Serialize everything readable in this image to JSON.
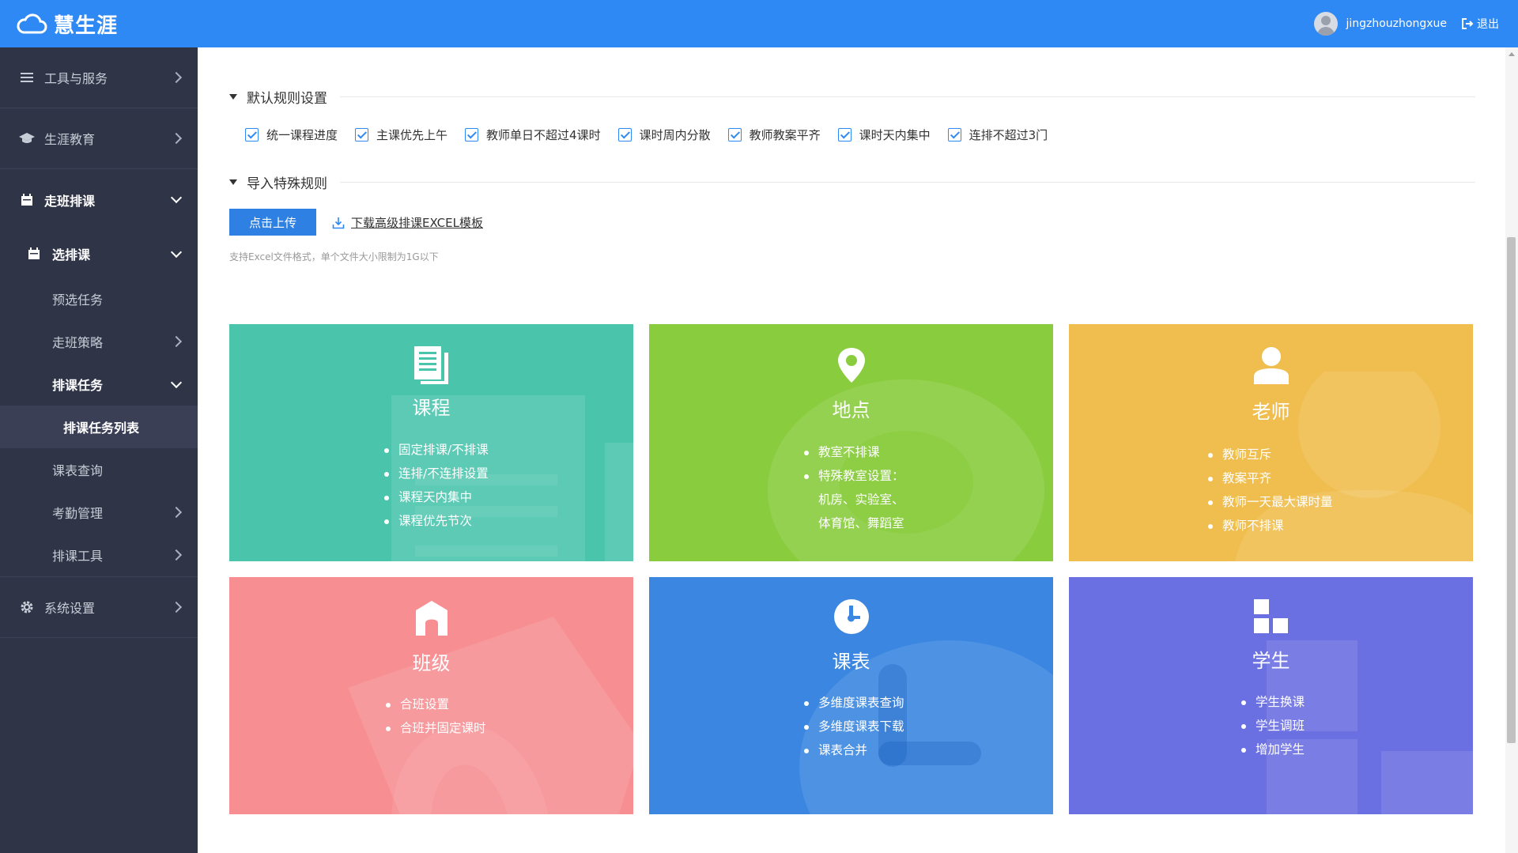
{
  "brand": {
    "name": "慧生涯"
  },
  "header": {
    "username": "jingzhouzhongxue",
    "logout_label": "退出"
  },
  "sidebar": {
    "tools": "工具与服务",
    "career": "生涯教育",
    "walking": "走班排课",
    "select": "选排课",
    "preselect": "预选任务",
    "strategy": "走班策略",
    "task": "排课任务",
    "task_list": "排课任务列表",
    "schedule_query": "课表查询",
    "attendance": "考勤管理",
    "tools2": "排课工具",
    "settings": "系统设置"
  },
  "rules": {
    "default_title": "默认规则设置",
    "items": [
      "统一课程进度",
      "主课优先上午",
      "教师单日不超过4课时",
      "课时周内分散",
      "教师教案平齐",
      "课时天内集中",
      "连排不超过3门"
    ],
    "special_title": "导入特殊规则",
    "upload_label": "点击上传",
    "download_label": "下载高级排课EXCEL模板",
    "hint": "支持Excel文件格式，单个文件大小限制为1G以下"
  },
  "cards": {
    "course": {
      "title": "课程",
      "items": [
        "固定排课/不排课",
        "连排/不连排设置",
        "课程天内集中",
        "课程优先节次"
      ],
      "color": "#4ac5ac"
    },
    "place": {
      "title": "地点",
      "items": [
        "教室不排课",
        "特殊教室设置：",
        "机房、实验室、",
        "体育馆、舞蹈室"
      ],
      "color": "#89cc3d"
    },
    "teacher": {
      "title": "老师",
      "items": [
        "教师互斥",
        "教案平齐",
        "教师一天最大课时量",
        "教师不排课"
      ],
      "color": "#f0be4e"
    },
    "class": {
      "title": "班级",
      "items": [
        "合班设置",
        "合班并固定课时"
      ],
      "color": "#f78f92"
    },
    "timetable": {
      "title": "课表",
      "items": [
        "多维度课表查询",
        "多维度课表下载",
        "课表合并"
      ],
      "color": "#3a86e0"
    },
    "student": {
      "title": "学生",
      "items": [
        "学生换课",
        "学生调班",
        "增加学生"
      ],
      "color": "#6a6fe1"
    }
  }
}
